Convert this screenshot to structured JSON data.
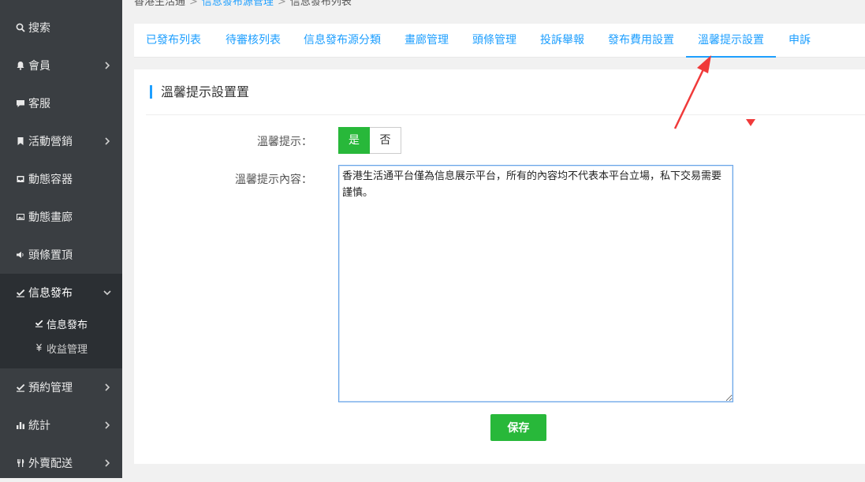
{
  "breadcrumb": {
    "home": "香港生活通",
    "section": "信息發布源管理",
    "current": "信息發布列表"
  },
  "sidebar": {
    "items": [
      {
        "label": "搜索",
        "icon": "search-icon"
      },
      {
        "label": "會員",
        "icon": "bell-icon"
      },
      {
        "label": "客服",
        "icon": "chat-icon"
      },
      {
        "label": "活動營銷",
        "icon": "bookmark-icon"
      },
      {
        "label": "動態容器",
        "icon": "inbox-icon"
      },
      {
        "label": "動態畫廊",
        "icon": "image-icon"
      },
      {
        "label": "頭條置頂",
        "icon": "megaphone-icon"
      },
      {
        "label": "信息發布",
        "icon": "edit-check-icon"
      },
      {
        "label": "預約管理",
        "icon": "edit-check-icon"
      },
      {
        "label": "統計",
        "icon": "bar-chart-icon"
      },
      {
        "label": "外賣配送",
        "icon": "cutlery-icon"
      }
    ],
    "sub_items": [
      {
        "label": "信息發布",
        "icon": "edit-check-icon"
      },
      {
        "label": "收益管理",
        "icon": "yen-icon"
      }
    ]
  },
  "tabs": [
    {
      "label": "已發布列表"
    },
    {
      "label": "待審核列表"
    },
    {
      "label": "信息發布源分類"
    },
    {
      "label": "畫廊管理"
    },
    {
      "label": "頭條管理"
    },
    {
      "label": "投訴舉報"
    },
    {
      "label": "發布費用設置"
    },
    {
      "label": "溫馨提示設置"
    },
    {
      "label": "申訴"
    }
  ],
  "section": {
    "title": "溫馨提示設置置"
  },
  "form": {
    "tip_label": "溫馨提示：",
    "toggle_yes": "是",
    "toggle_no": "否",
    "toggle_value": "是",
    "content_label": "溫馨提示內容：",
    "content_value": "香港生活通平台僅為信息展示平台，所有的內容均不代表本平台立場，私下交易需要謹慎。",
    "save_label": "保存"
  },
  "colors": {
    "accent": "#1e9fff",
    "success": "#28b83a",
    "sidebar_bg": "#3a3e42",
    "annotation": "#f03a3a"
  }
}
